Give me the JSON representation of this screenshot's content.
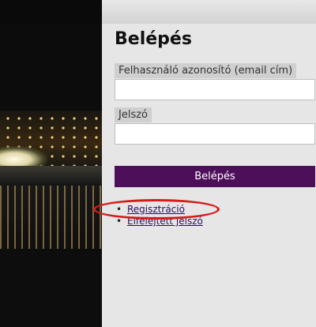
{
  "login": {
    "title": "Belépés",
    "username_label": "Felhasználó azonosító (email cím)",
    "username_value": "",
    "password_label": "Jelszó",
    "password_value": "",
    "submit_label": "Belépés"
  },
  "links": {
    "register": "Regisztráció",
    "forgot_password": "Elfelejtett jelszó"
  },
  "colors": {
    "button_bg": "#4d0f5a",
    "highlight": "#d71a1a"
  }
}
